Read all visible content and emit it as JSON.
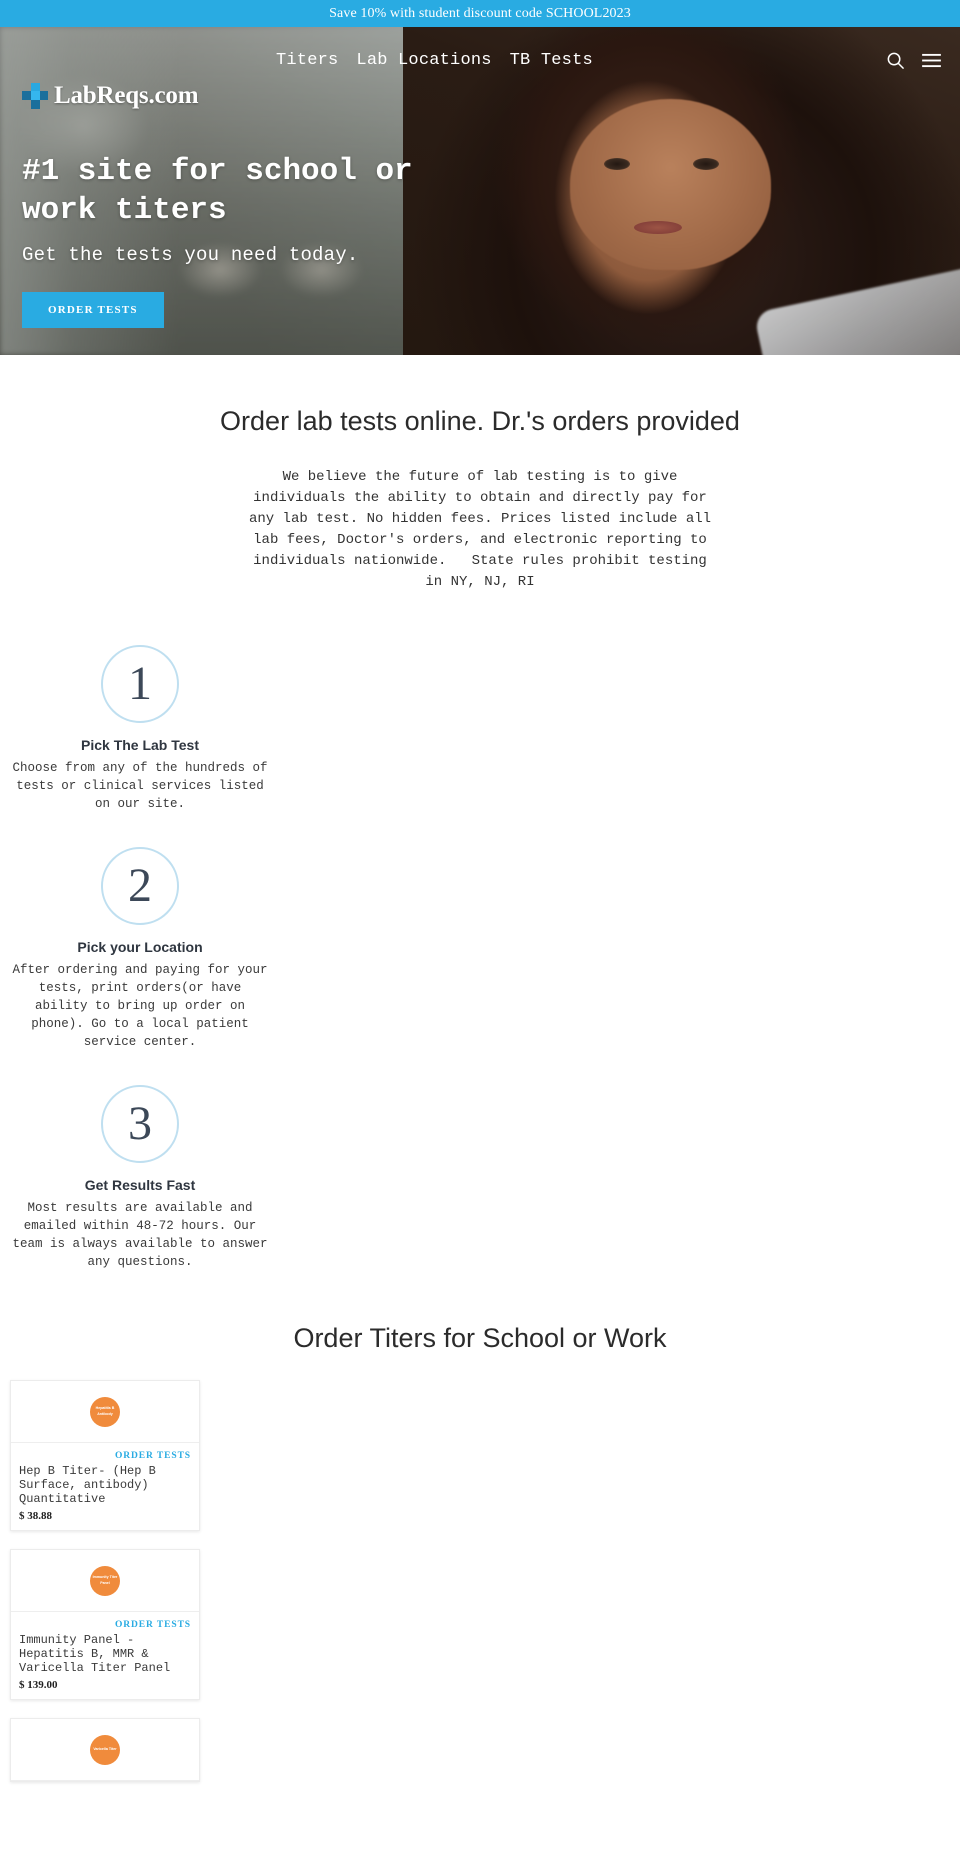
{
  "announcement": {
    "text": "Save 10% with student discount code SCHOOL2023"
  },
  "header": {
    "logo_text": "LabReqs.com",
    "nav": [
      {
        "label": "Titers"
      },
      {
        "label": "Lab Locations"
      },
      {
        "label": "TB Tests"
      }
    ],
    "icons": {
      "search": "search-icon",
      "menu": "hamburger-menu-icon"
    }
  },
  "hero": {
    "title": "#1 site for school or work titers",
    "subtitle": "Get the tests you need today.",
    "cta_label": "ORDER TESTS"
  },
  "intro": {
    "title": "Order lab tests online. Dr.'s orders provided",
    "body": "We believe the future of lab testing is to give individuals the ability to obtain and directly pay for any lab test. No hidden fees. Prices listed include all lab fees, Doctor's orders, and electronic reporting to individuals nationwide.   State rules prohibit testing in NY, NJ, RI"
  },
  "steps": [
    {
      "number": "1",
      "title": "Pick The Lab Test",
      "description": "Choose from any of the hundreds of tests or clinical services listed on our site."
    },
    {
      "number": "2",
      "title": "Pick your Location",
      "description": "After ordering and paying for your tests, print orders(or have ability to bring up order on phone). Go to a local patient service center."
    },
    {
      "number": "3",
      "title": "Get Results Fast",
      "description": "Most results are available and emailed within 48-72 hours. Our team is always available to answer any questions."
    }
  ],
  "products": {
    "title": "Order Titers for School or Work",
    "order_label": "ORDER TESTS",
    "items": [
      {
        "thumb_text": "Hepatitis B Antibody",
        "name": "Hep B Titer- (Hep B Surface, antibody) Quantitative",
        "price": "$ 38.88"
      },
      {
        "thumb_text": "Immunity Titer Panel",
        "name": "Immunity Panel - Hepatitis B, MMR & Varicella Titer Panel",
        "price": "$ 139.00"
      },
      {
        "thumb_text": "Varicella Titer",
        "name": "",
        "price": ""
      }
    ]
  },
  "colors": {
    "accent": "#29ABE2",
    "thumb": "#F08B3C",
    "circle_border": "#bfdff0",
    "step_number": "#3c4858"
  }
}
